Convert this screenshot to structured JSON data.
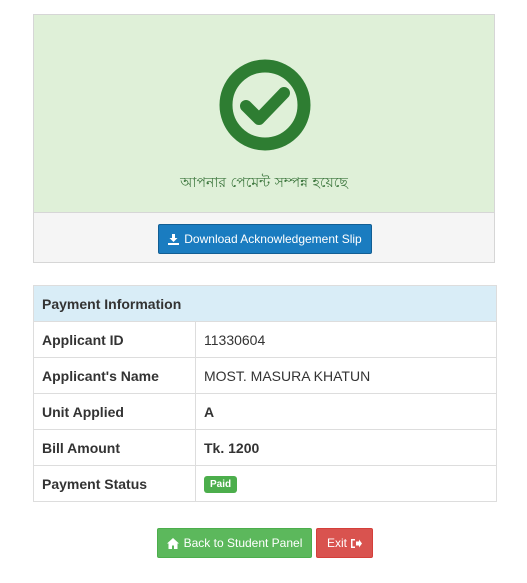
{
  "success": {
    "message": "আপনার পেমেন্ট সম্পন্ন হয়েছে",
    "icon": "check-circle-icon",
    "download_label": "Download Acknowledgement Slip"
  },
  "payment_info": {
    "header": "Payment Information",
    "rows": [
      {
        "label": "Applicant ID",
        "value": "11330604"
      },
      {
        "label": "Applicant's Name",
        "value": "MOST. MASURA KHATUN"
      },
      {
        "label": "Unit Applied",
        "value": "A"
      },
      {
        "label": "Bill Amount",
        "value": "Tk. 1200"
      },
      {
        "label": "Payment Status",
        "value": "Paid"
      }
    ]
  },
  "actions": {
    "back_label": "Back to Student Panel",
    "exit_label": "Exit"
  },
  "colors": {
    "success_bg": "#dff0d8",
    "check": "#2e7d32",
    "primary": "#1a7cc0",
    "info_header": "#d9edf7",
    "success_btn": "#5cb85c",
    "danger_btn": "#d9534f"
  }
}
